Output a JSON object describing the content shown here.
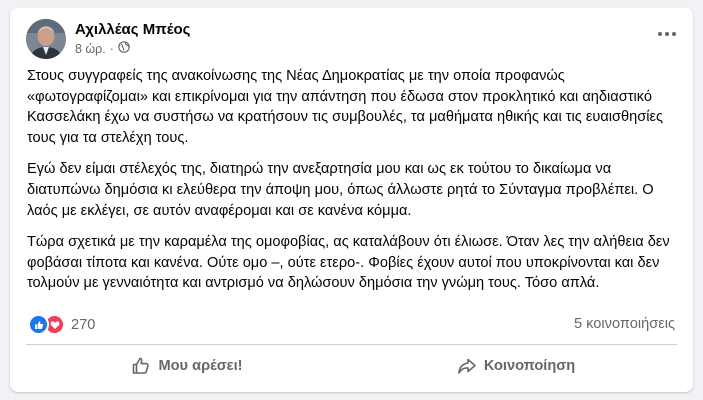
{
  "post": {
    "author": "Αχιλλέας Μπέος",
    "time": "8 ώρ.",
    "privacy_icon": "globe-icon",
    "paragraphs": [
      "Στους συγγραφείς της ανακοίνωσης της Νέας Δημοκρατίας  με την οποία προφανώς «φωτογραφίζομαι» και επικρίνομαι για την απάντηση που έδωσα στον προκλητικό και αηδιαστικό Κασσελάκη έχω να συστήσω να κρατήσουν τις συμβουλές, τα μαθήματα ηθικής και τις ευαισθησίες τους για τα στελέχη τους.",
      "Εγώ δεν είμαι στέλεχός της, διατηρώ την ανεξαρτησία μου και ως εκ τούτου το δικαίωμα να διατυπώνω δημόσια κι ελεύθερα την άποψη μου, όπως άλλωστε ρητά το Σύνταγμα προβλέπει. Ο λαός με εκλέγει, σε αυτόν αναφέρομαι και σε κανένα κόμμα.",
      "Τώρα σχετικά με την καραμέλα της ομοφοβίας, ας  καταλάβουν ότι έλιωσε. Όταν λες την αλήθεια δεν φοβάσαι τίποτα και κανένα. Ούτε ομο –, ούτε ετερο-. Φοβίες έχουν αυτοί που υποκρίνονται και δεν τολμούν με γενναιότητα και αντρισμό να δηλώσουν δημόσια την γνώμη τους. Τόσο απλά."
    ],
    "reaction_count": "270",
    "shares": "5 κοινοποιήσεις",
    "like_label": "Μου αρέσει!",
    "share_label": "Κοινοποίηση"
  },
  "colors": {
    "like_blue": "#1877f2",
    "love_red": "#f33e58",
    "secondary_text": "#65676b"
  }
}
